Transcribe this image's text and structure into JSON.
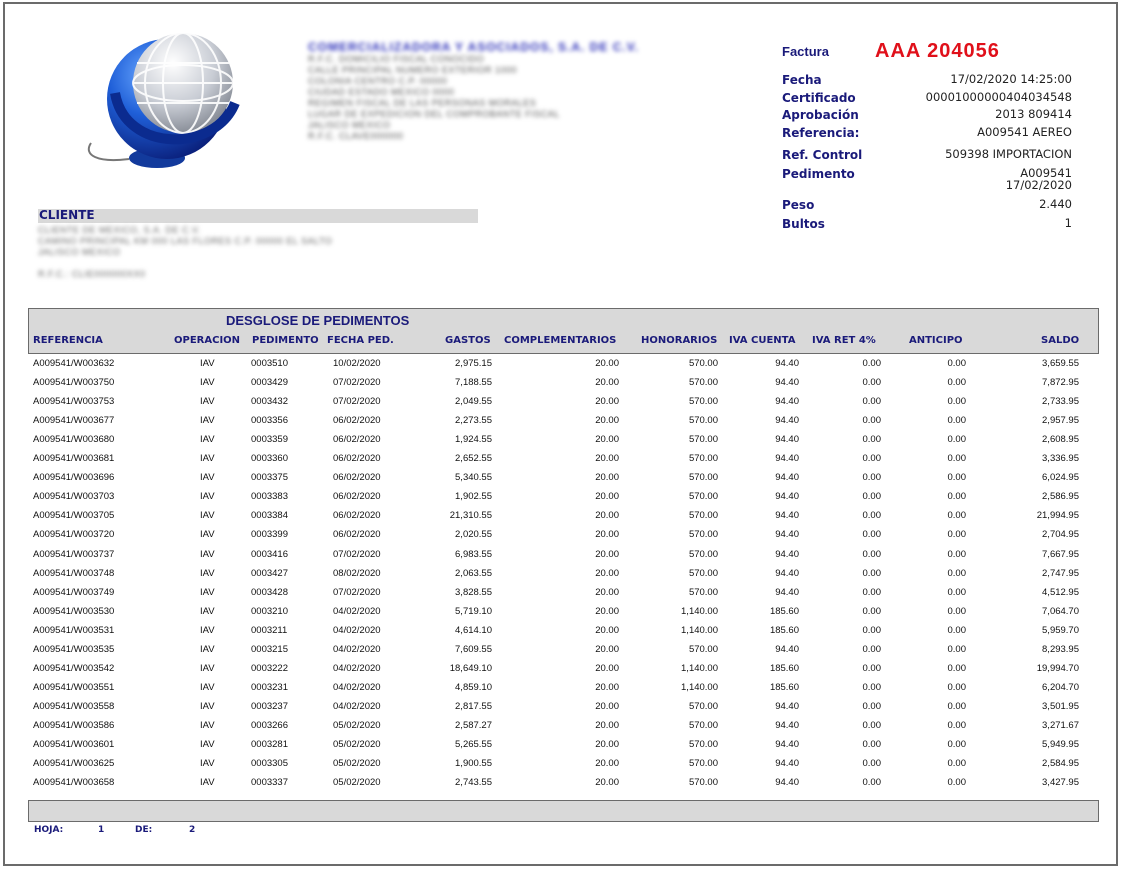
{
  "emisor": {
    "name": "COMERCIALIZADORA Y ASOCIADOS, S.A. DE C.V.",
    "lines": [
      "R.F.C. DOMICILIO FISCAL CONOCIDO",
      "CALLE PRINCIPAL NUMERO EXTERIOR 1000",
      "COLONIA CENTRO C.P. 00000",
      "CIUDAD ESTADO MEXICO 0000",
      "REGIMEN FISCAL DE LAS PERSONAS MORALES",
      "LUGAR DE EXPEDICION DEL COMPROBANTE FISCAL",
      "JALISCO MEXICO",
      "R.F.C. CLAVE000000"
    ]
  },
  "factura": {
    "label": "Factura",
    "number": "AAA 204056",
    "fields": [
      {
        "label": "Fecha",
        "value": "17/02/2020 14:25:00"
      },
      {
        "label": "Certificado",
        "value": "00001000000404034548"
      },
      {
        "label": "Aprobación",
        "value": "2013 809414"
      },
      {
        "label": "Referencia:",
        "value": "A009541 AEREO"
      },
      {
        "label": "Ref. Control",
        "value": "509398 IMPORTACION"
      },
      {
        "label": "Pedimento",
        "value": "A009541",
        "value2": "17/02/2020"
      },
      {
        "label": "Peso",
        "value": "2.440"
      },
      {
        "label": "Bultos",
        "value": "1"
      }
    ]
  },
  "cliente": {
    "title": "CLIENTE",
    "lines": [
      "CLIENTE DE MEXICO, S.A. DE C.V.",
      "CAMINO PRINCIPAL KM 000 LAS FLORES C.P. 00000 EL SALTO",
      "JALISCO MEXICO",
      "",
      "R.F.C.: CLIE000000XX0"
    ]
  },
  "table": {
    "title": "DESGLOSE DE PEDIMENTOS",
    "headers": {
      "referencia": "REFERENCIA",
      "operacion": "OPERACION",
      "pedimento": "PEDIMENTO",
      "fecha": "FECHA PED.",
      "gastos": "GASTOS",
      "complementarios": "COMPLEMENTARIOS",
      "honorarios": "HONORARIOS",
      "iva_cuenta": "IVA CUENTA",
      "iva_ret": "IVA RET 4%",
      "anticipo": "ANTICIPO",
      "saldo": "SALDO"
    },
    "rows": [
      [
        "A009541/W003632",
        "IAV",
        "0003510",
        "10/02/2020",
        "2,975.15",
        "20.00",
        "570.00",
        "94.40",
        "0.00",
        "0.00",
        "3,659.55"
      ],
      [
        "A009541/W003750",
        "IAV",
        "0003429",
        "07/02/2020",
        "7,188.55",
        "20.00",
        "570.00",
        "94.40",
        "0.00",
        "0.00",
        "7,872.95"
      ],
      [
        "A009541/W003753",
        "IAV",
        "0003432",
        "07/02/2020",
        "2,049.55",
        "20.00",
        "570.00",
        "94.40",
        "0.00",
        "0.00",
        "2,733.95"
      ],
      [
        "A009541/W003677",
        "IAV",
        "0003356",
        "06/02/2020",
        "2,273.55",
        "20.00",
        "570.00",
        "94.40",
        "0.00",
        "0.00",
        "2,957.95"
      ],
      [
        "A009541/W003680",
        "IAV",
        "0003359",
        "06/02/2020",
        "1,924.55",
        "20.00",
        "570.00",
        "94.40",
        "0.00",
        "0.00",
        "2,608.95"
      ],
      [
        "A009541/W003681",
        "IAV",
        "0003360",
        "06/02/2020",
        "2,652.55",
        "20.00",
        "570.00",
        "94.40",
        "0.00",
        "0.00",
        "3,336.95"
      ],
      [
        "A009541/W003696",
        "IAV",
        "0003375",
        "06/02/2020",
        "5,340.55",
        "20.00",
        "570.00",
        "94.40",
        "0.00",
        "0.00",
        "6,024.95"
      ],
      [
        "A009541/W003703",
        "IAV",
        "0003383",
        "06/02/2020",
        "1,902.55",
        "20.00",
        "570.00",
        "94.40",
        "0.00",
        "0.00",
        "2,586.95"
      ],
      [
        "A009541/W003705",
        "IAV",
        "0003384",
        "06/02/2020",
        "21,310.55",
        "20.00",
        "570.00",
        "94.40",
        "0.00",
        "0.00",
        "21,994.95"
      ],
      [
        "A009541/W003720",
        "IAV",
        "0003399",
        "06/02/2020",
        "2,020.55",
        "20.00",
        "570.00",
        "94.40",
        "0.00",
        "0.00",
        "2,704.95"
      ],
      [
        "A009541/W003737",
        "IAV",
        "0003416",
        "07/02/2020",
        "6,983.55",
        "20.00",
        "570.00",
        "94.40",
        "0.00",
        "0.00",
        "7,667.95"
      ],
      [
        "A009541/W003748",
        "IAV",
        "0003427",
        "08/02/2020",
        "2,063.55",
        "20.00",
        "570.00",
        "94.40",
        "0.00",
        "0.00",
        "2,747.95"
      ],
      [
        "A009541/W003749",
        "IAV",
        "0003428",
        "07/02/2020",
        "3,828.55",
        "20.00",
        "570.00",
        "94.40",
        "0.00",
        "0.00",
        "4,512.95"
      ],
      [
        "A009541/W003530",
        "IAV",
        "0003210",
        "04/02/2020",
        "5,719.10",
        "20.00",
        "1,140.00",
        "185.60",
        "0.00",
        "0.00",
        "7,064.70"
      ],
      [
        "A009541/W003531",
        "IAV",
        "0003211",
        "04/02/2020",
        "4,614.10",
        "20.00",
        "1,140.00",
        "185.60",
        "0.00",
        "0.00",
        "5,959.70"
      ],
      [
        "A009541/W003535",
        "IAV",
        "0003215",
        "04/02/2020",
        "7,609.55",
        "20.00",
        "570.00",
        "94.40",
        "0.00",
        "0.00",
        "8,293.95"
      ],
      [
        "A009541/W003542",
        "IAV",
        "0003222",
        "04/02/2020",
        "18,649.10",
        "20.00",
        "1,140.00",
        "185.60",
        "0.00",
        "0.00",
        "19,994.70"
      ],
      [
        "A009541/W003551",
        "IAV",
        "0003231",
        "04/02/2020",
        "4,859.10",
        "20.00",
        "1,140.00",
        "185.60",
        "0.00",
        "0.00",
        "6,204.70"
      ],
      [
        "A009541/W003558",
        "IAV",
        "0003237",
        "04/02/2020",
        "2,817.55",
        "20.00",
        "570.00",
        "94.40",
        "0.00",
        "0.00",
        "3,501.95"
      ],
      [
        "A009541/W003586",
        "IAV",
        "0003266",
        "05/02/2020",
        "2,587.27",
        "20.00",
        "570.00",
        "94.40",
        "0.00",
        "0.00",
        "3,271.67"
      ],
      [
        "A009541/W003601",
        "IAV",
        "0003281",
        "05/02/2020",
        "5,265.55",
        "20.00",
        "570.00",
        "94.40",
        "0.00",
        "0.00",
        "5,949.95"
      ],
      [
        "A009541/W003625",
        "IAV",
        "0003305",
        "05/02/2020",
        "1,900.55",
        "20.00",
        "570.00",
        "94.40",
        "0.00",
        "0.00",
        "2,584.95"
      ],
      [
        "A009541/W003658",
        "IAV",
        "0003337",
        "05/02/2020",
        "2,743.55",
        "20.00",
        "570.00",
        "94.40",
        "0.00",
        "0.00",
        "3,427.95"
      ]
    ]
  },
  "footer": {
    "hoja_label": "HOJA:",
    "hoja_value": "1",
    "de_label": "DE:",
    "de_value": "2"
  },
  "colors": {
    "navy": "#1a1a7a",
    "red": "#e0101a",
    "band": "#d9d9d9"
  }
}
